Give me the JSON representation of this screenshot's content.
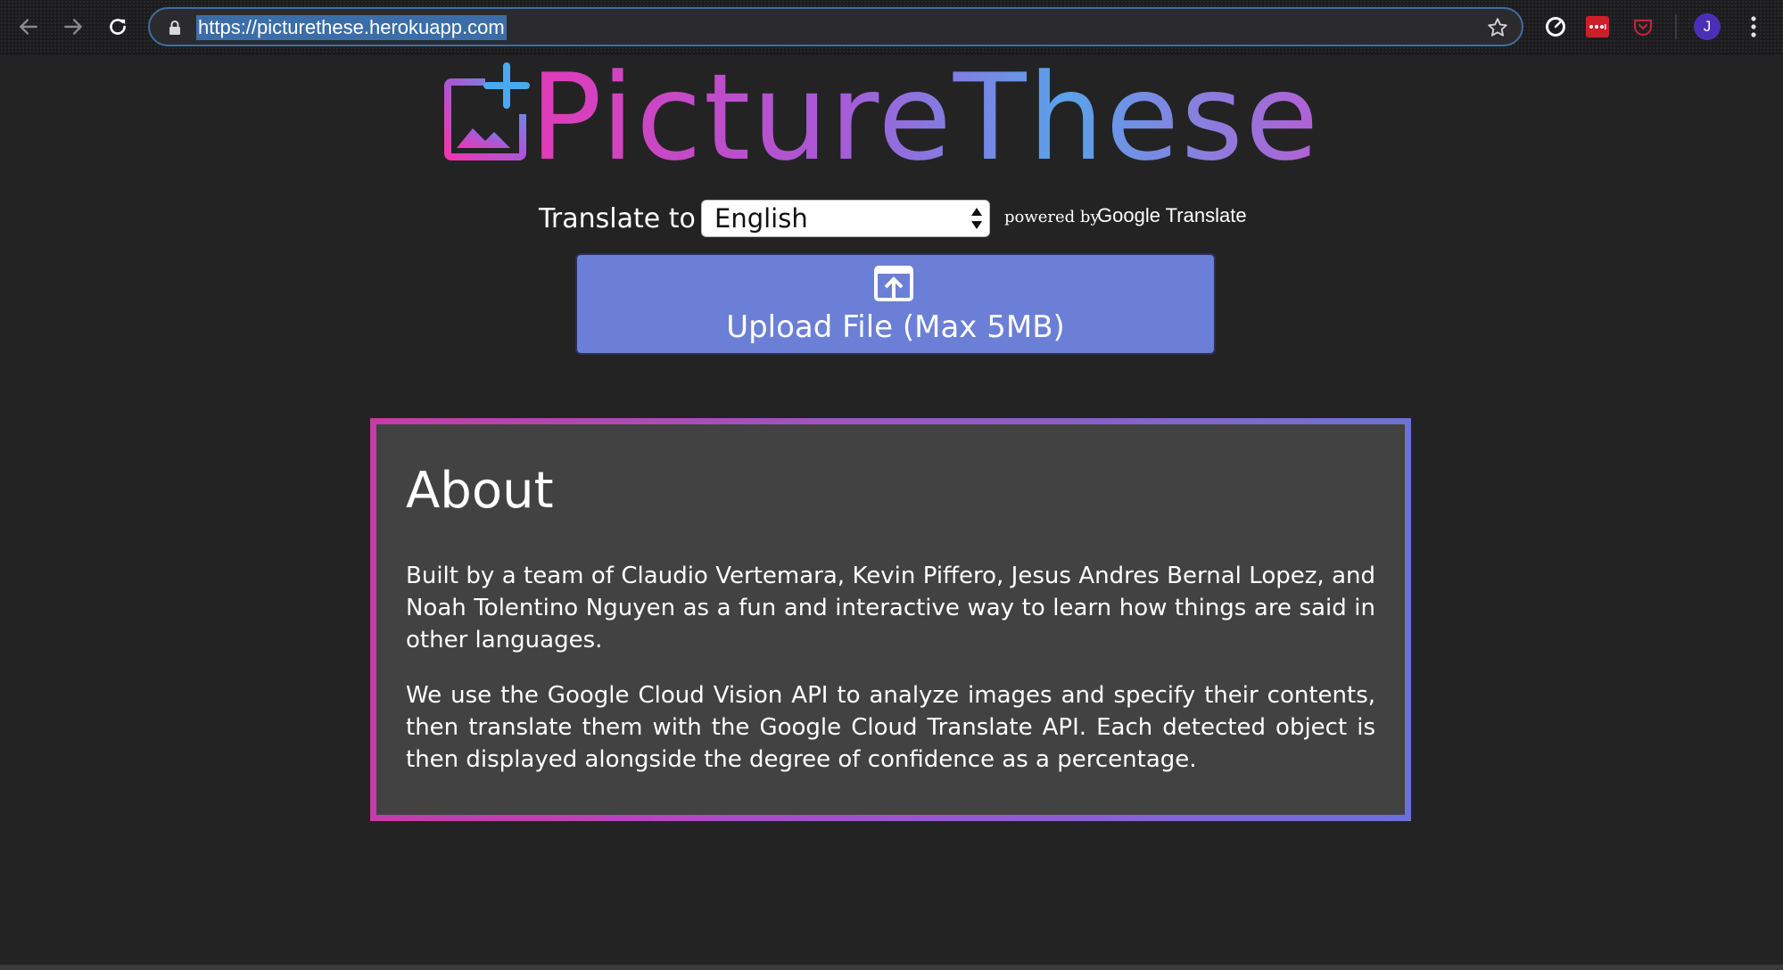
{
  "browser": {
    "url": "https://picturethese.herokuapp.com",
    "avatar_initial": "J"
  },
  "logo": {
    "text": "PictureThese"
  },
  "translate": {
    "label": "Translate to",
    "selected_language": "English",
    "powered_by": "powered by",
    "provider_google": "Google",
    "provider_translate": "Translate"
  },
  "upload": {
    "label": "Upload File (Max 5MB)"
  },
  "about": {
    "title": "About",
    "paragraph1": "Built by a team of Claudio Vertemara, Kevin Piffero, Jesus Andres Bernal Lopez, and Noah Tolentino Nguyen as a fun and interactive way to learn how things are said in other languages.",
    "paragraph2": "We use the Google Cloud Vision API to analyze images and specify their contents, then translate them with the Google Cloud Translate API. Each detected object is then displayed alongside the degree of confidence as a percentage."
  },
  "colors": {
    "page_background": "#232324",
    "upload_button": "#6b7fd7",
    "card_background": "#434242",
    "gradient_pink": "#e13bb7",
    "gradient_purple": "#a958d6",
    "gradient_blue": "#5aa2ea"
  },
  "icons": {
    "back": "back-arrow-icon",
    "forward": "forward-arrow-icon",
    "reload": "reload-icon",
    "lock": "lock-icon",
    "bookmark": "star-icon",
    "upload": "upload-icon"
  }
}
